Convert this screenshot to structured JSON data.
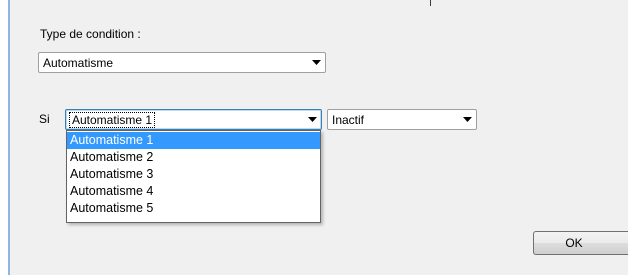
{
  "dialog": {
    "condition_type_label": "Type de condition :",
    "condition_type_value": "Automatisme",
    "si_label": "Si",
    "automation_value": "Automatisme 1",
    "state_value": "Inactif",
    "ok_label": "OK"
  },
  "dropdown": {
    "items": [
      {
        "label": "Automatisme 1",
        "selected": true
      },
      {
        "label": "Automatisme 2",
        "selected": false
      },
      {
        "label": "Automatisme 3",
        "selected": false
      },
      {
        "label": "Automatisme 4",
        "selected": false
      },
      {
        "label": "Automatisme 5",
        "selected": false
      }
    ]
  },
  "icons": {
    "combo_arrow": "chevron-down-icon"
  },
  "colors": {
    "selection": "#3399ff",
    "window_background": "#f0f0f0",
    "frame_accent": "#8fb5e6"
  }
}
